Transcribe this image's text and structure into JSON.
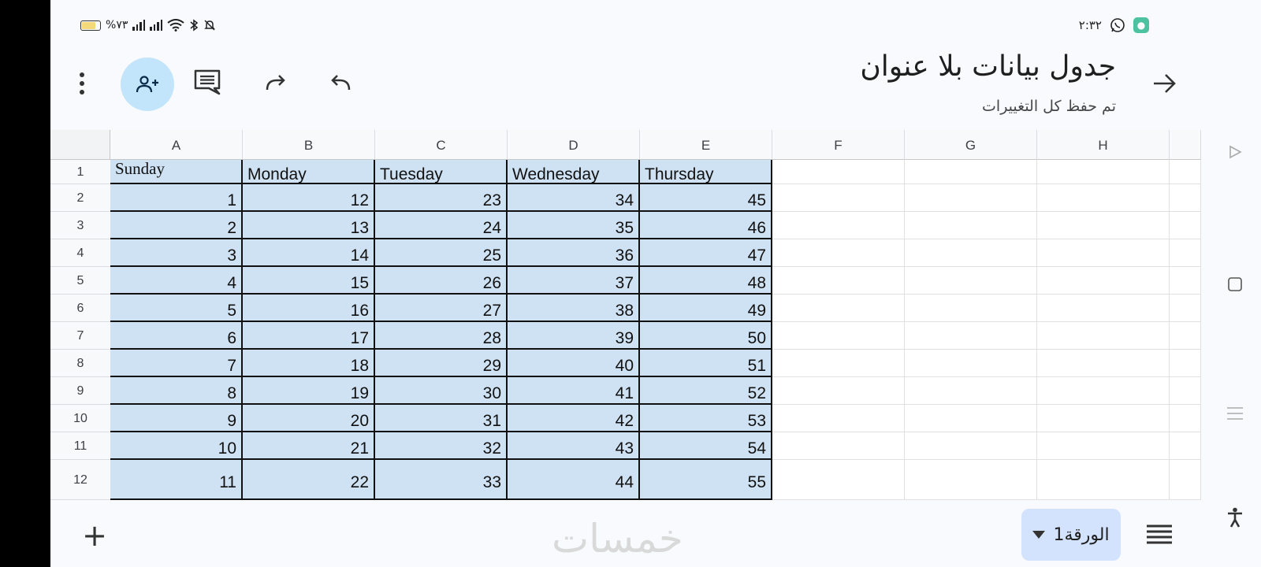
{
  "status_bar": {
    "battery_percent": "%٧٣",
    "time": "٢:٣٢"
  },
  "header": {
    "title": "جدول بيانات بلا عنوان",
    "subtitle": "تم حفظ كل التغييرات"
  },
  "icons": {
    "share": "add-person-icon",
    "comment": "comment-icon",
    "redo": "redo-icon",
    "undo": "undo-icon",
    "more": "more-vert-icon",
    "back": "arrow-forward-icon"
  },
  "columns": [
    "A",
    "B",
    "C",
    "D",
    "E",
    "F",
    "G",
    "H"
  ],
  "rows": [
    "1",
    "2",
    "3",
    "4",
    "5",
    "6",
    "7",
    "8",
    "9",
    "10",
    "11",
    "12"
  ],
  "table": {
    "headers": [
      "Sunday",
      "Monday",
      "Tuesday",
      "Wednesday",
      "Thursday"
    ],
    "data": [
      [
        "1",
        "12",
        "23",
        "34",
        "45"
      ],
      [
        "2",
        "13",
        "24",
        "35",
        "46"
      ],
      [
        "3",
        "14",
        "25",
        "36",
        "47"
      ],
      [
        "4",
        "15",
        "26",
        "37",
        "48"
      ],
      [
        "5",
        "16",
        "27",
        "38",
        "49"
      ],
      [
        "6",
        "17",
        "28",
        "39",
        "50"
      ],
      [
        "7",
        "18",
        "29",
        "40",
        "51"
      ],
      [
        "8",
        "19",
        "30",
        "41",
        "52"
      ],
      [
        "9",
        "20",
        "31",
        "42",
        "53"
      ],
      [
        "10",
        "21",
        "32",
        "43",
        "54"
      ],
      [
        "11",
        "22",
        "33",
        "44",
        "55"
      ]
    ],
    "fill_color": "#cfe2f3"
  },
  "bottom": {
    "add_label": "+",
    "sheet_tab_label": "الورقة1",
    "watermark": "خمسات"
  }
}
